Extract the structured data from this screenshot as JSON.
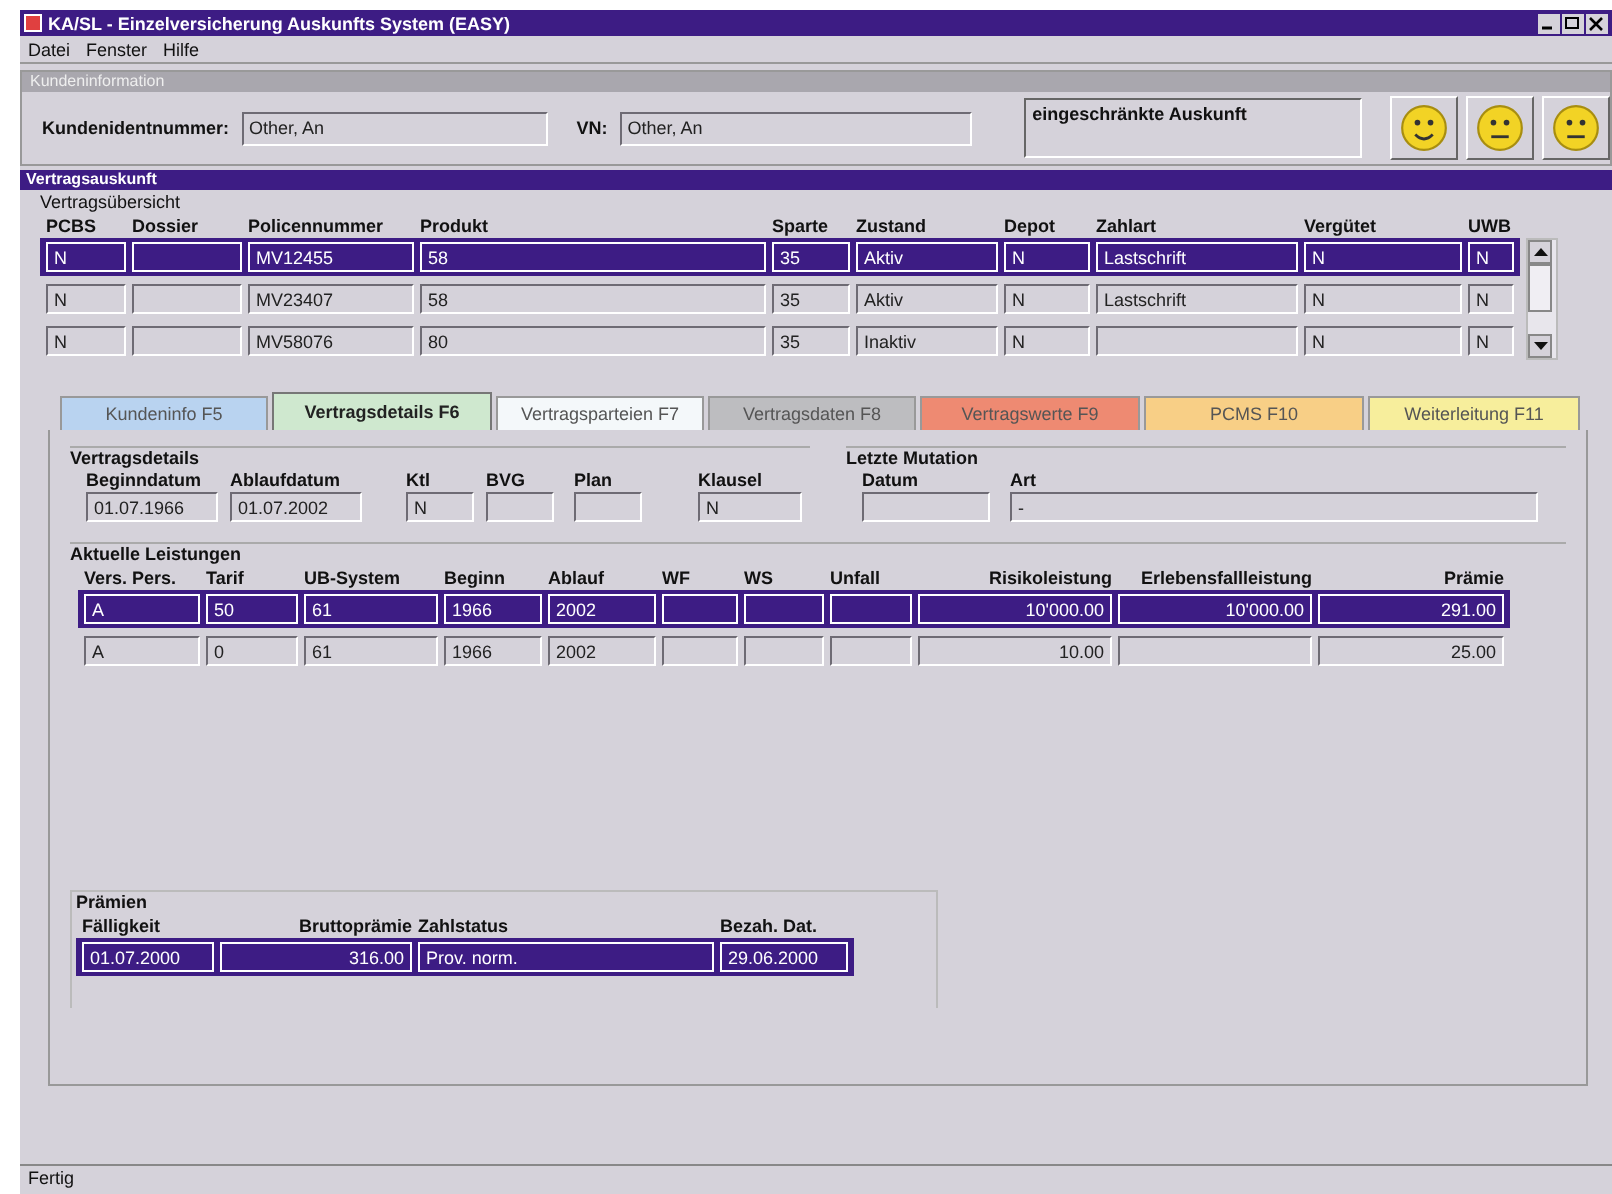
{
  "window": {
    "title": "KA/SL - Einzelversicherung Auskunfts System (EASY)"
  },
  "menu": [
    "Datei",
    "Fenster",
    "Hilfe"
  ],
  "customer": {
    "title": "Kundeninformation",
    "fields": [
      {
        "label": "Kundenidentnummer:",
        "value": "Other, An"
      },
      {
        "label": "VN:",
        "value": "Other, An"
      }
    ],
    "notice": "eingeschränkte Auskunft",
    "smileys": [
      {
        "kind": "happy"
      },
      {
        "kind": "neutral"
      },
      {
        "kind": "neutral"
      }
    ]
  },
  "contract": {
    "title": "Vertragsauskunft"
  },
  "overview": {
    "title": "Vertragsübersicht",
    "columns": [
      {
        "label": "PCBS"
      },
      {
        "label": "Dossier"
      },
      {
        "label": "Policennummer"
      },
      {
        "label": "Produkt"
      },
      {
        "label": "Sparte"
      },
      {
        "label": "Zustand"
      },
      {
        "label": "Depot"
      },
      {
        "label": "Zahlart"
      },
      {
        "label": "Vergütet"
      },
      {
        "label": "UWB"
      }
    ],
    "rows": [
      {
        "selected": true,
        "cells": [
          "N",
          null,
          "MV12455",
          "58",
          "35",
          "Aktiv",
          "N",
          "Lastschrift",
          "N",
          "N"
        ]
      },
      {
        "selected": false,
        "cells": [
          "N",
          null,
          "MV23407",
          "58",
          "35",
          "Aktiv",
          "N",
          "Lastschrift",
          "N",
          "N"
        ]
      },
      {
        "selected": false,
        "cells": [
          "N",
          null,
          "MV58076",
          "80",
          "35",
          "Inaktiv",
          "N",
          null,
          "N",
          "N"
        ]
      }
    ]
  },
  "tabs": [
    {
      "label": "Kundeninfo F5",
      "selected": false,
      "color": "#b9d3f0"
    },
    {
      "label": "Vertragsdetails F6",
      "selected": true,
      "color": "#cfe8cf"
    },
    {
      "label": "Vertragsparteien F7",
      "selected": false,
      "color": "#f4f8fa"
    },
    {
      "label": "Vertragsdaten F8",
      "selected": false,
      "color": "#bdbdc0"
    },
    {
      "label": "Vertragswerte F9",
      "selected": false,
      "color": "#ee8a72"
    },
    {
      "label": "PCMS F10",
      "selected": false,
      "color": "#f8cf86"
    },
    {
      "label": "Weiterleitung F11",
      "selected": false,
      "color": "#f7ee9c"
    }
  ],
  "details": {
    "title": "Vertragsdetails",
    "fields": [
      {
        "label": "Beginndatum",
        "value": "01.07.1966"
      },
      {
        "label": "Ablaufdatum",
        "value": "01.07.2002"
      },
      {
        "label": "Ktl",
        "value": "N"
      },
      {
        "label": "BVG"
      },
      {
        "label": "Plan"
      },
      {
        "label": "Klausel",
        "value": "N"
      }
    ]
  },
  "last_mutation": {
    "title": "Letzte Mutation",
    "fields": [
      {
        "label": "Datum"
      },
      {
        "label": "Art",
        "value": "-"
      }
    ]
  },
  "benefits": {
    "title": "Aktuelle Leistungen",
    "columns": [
      {
        "label": "Vers. Pers."
      },
      {
        "label": "Tarif"
      },
      {
        "label": "UB-System"
      },
      {
        "label": "Beginn"
      },
      {
        "label": "Ablauf"
      },
      {
        "label": "WF"
      },
      {
        "label": "WS"
      },
      {
        "label": "Unfall"
      },
      {
        "label": "Risikoleistung"
      },
      {
        "label": "Erlebensfallleistung"
      },
      {
        "label": "Prämie"
      }
    ],
    "rows": [
      {
        "selected": true,
        "cells": [
          "A",
          "50",
          "61",
          "1966",
          "2002",
          null,
          null,
          null,
          "10'000.00",
          "10'000.00",
          "291.00"
        ]
      },
      {
        "selected": false,
        "cells": [
          "A",
          "0",
          "61",
          "1966",
          "2002",
          null,
          null,
          null,
          "10.00",
          null,
          "25.00"
        ]
      }
    ]
  },
  "premiums": {
    "title": "Prämien",
    "columns": [
      {
        "label": "Fälligkeit"
      },
      {
        "label": "Bruttoprämie"
      },
      {
        "label": "Zahlstatus"
      },
      {
        "label": "Bezah. Dat."
      }
    ],
    "rows": [
      {
        "selected": true,
        "cells": [
          "01.07.2000",
          "316.00",
          "Prov. norm.",
          "29.06.2000"
        ]
      }
    ]
  },
  "status_bar": "Fertig"
}
